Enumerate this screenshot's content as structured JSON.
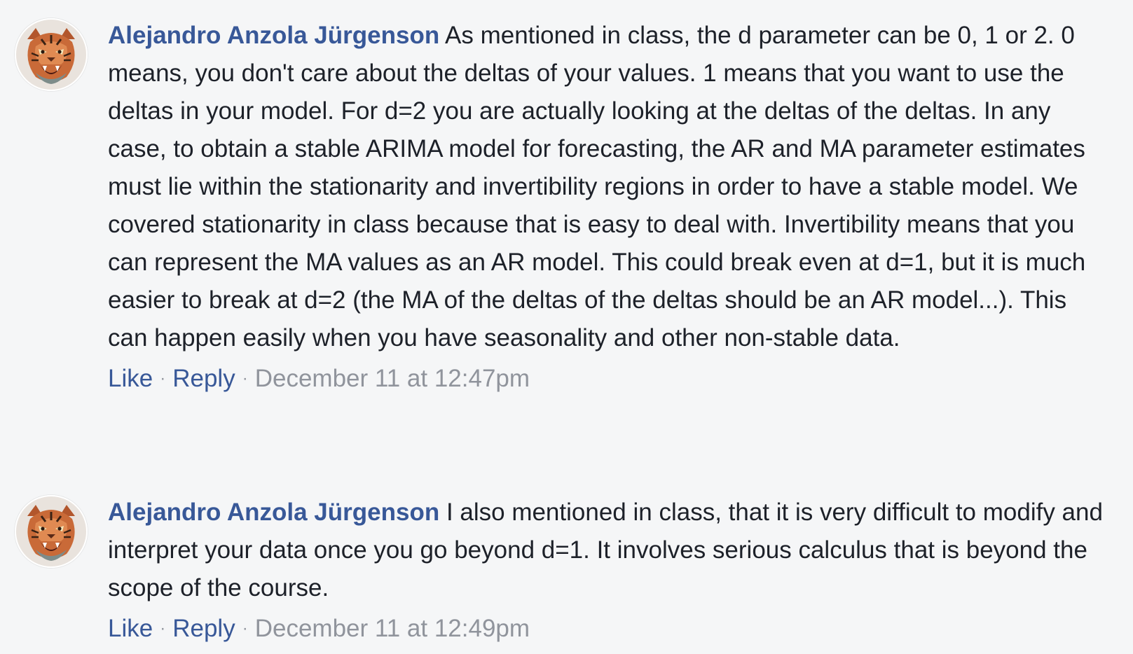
{
  "comments": [
    {
      "author": "Alejandro Anzola Jürgenson",
      "text": "As mentioned in class, the d parameter can be 0, 1 or 2. 0 means, you don't care about the deltas of your values. 1 means that you want to use the deltas in your model. For d=2 you are actually looking at the deltas of the deltas. In any case, to obtain a stable ARIMA model for forecasting, the AR and MA parameter estimates must lie within the stationarity and invertibility regions in order to have a stable model. We covered stationarity in class because that is easy to deal with. Invertibility means that you can represent the MA values as an AR model. This could break even at d=1, but it is much easier to break at d=2 (the MA of the deltas of the deltas should be an AR model...). This can happen easily when you have seasonality and other non-stable data.",
      "like_label": "Like",
      "reply_label": "Reply",
      "separator": "·",
      "timestamp": "December 11 at 12:47pm",
      "avatar_icon": "tiger-avatar-icon"
    },
    {
      "author": "Alejandro Anzola Jürgenson",
      "text": "I also mentioned in class, that it is very difficult to modify and interpret your data once you go beyond d=1. It involves serious calculus that is beyond the scope of the course.",
      "like_label": "Like",
      "reply_label": "Reply",
      "separator": "·",
      "timestamp": "December 11 at 12:49pm",
      "avatar_icon": "tiger-avatar-icon"
    }
  ],
  "colors": {
    "background": "#f5f6f7",
    "author": "#385898",
    "text": "#1d2129",
    "link": "#385898",
    "meta": "#90949c"
  }
}
